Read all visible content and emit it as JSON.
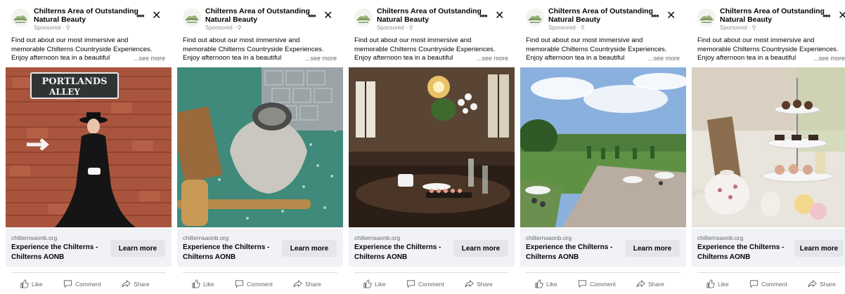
{
  "cards": [
    {
      "page_name": "Chilterns Area of Outstanding Natural Beauty",
      "sponsored": "Sponsored · ⚲",
      "text_lines": [
        "Find out about our most immersive and",
        "memorable Chilterns Countryside Experiences.",
        "Enjoy afternoon tea in a beautiful"
      ],
      "see_more": "...see more",
      "sign_line1": "PORTLANDS",
      "sign_line2": "ALLEY",
      "domain": "chilternsaonb.org",
      "headline": "Experience the Chilterns - Chilterns AONB",
      "cta": "Learn more",
      "like": "Like",
      "comment": "Comment",
      "share": "Share"
    },
    {
      "page_name": "Chilterns Area of Outstanding Natural Beauty",
      "sponsored": "Sponsored · ⚲",
      "text_lines": [
        "Find out about our most immersive and",
        "memorable Chilterns Countryside Experiences.",
        "Enjoy afternoon tea in a beautiful"
      ],
      "see_more": "...see more",
      "domain": "chilternsaonb.org",
      "headline": "Experience the Chilterns - Chilterns AONB",
      "cta": "Learn more",
      "like": "Like",
      "comment": "Comment",
      "share": "Share"
    },
    {
      "page_name": "Chilterns Area of Outstanding Natural Beauty",
      "sponsored": "Sponsored · ⚲",
      "text_lines": [
        "Find out about our most immersive and",
        "memorable Chilterns Countryside Experiences.",
        "Enjoy afternoon tea in a beautiful"
      ],
      "see_more": "...see more",
      "domain": "chilternsaonb.org",
      "headline": "Experience the Chilterns - Chilterns AONB",
      "cta": "Learn more",
      "like": "Like",
      "comment": "Comment",
      "share": "Share"
    },
    {
      "page_name": "Chilterns Area of Outstanding Natural Beauty",
      "sponsored": "Sponsored · ⚲",
      "text_lines": [
        "Find out about our most immersive and",
        "memorable Chilterns Countryside Experiences.",
        "Enjoy afternoon tea in a beautiful"
      ],
      "see_more": "...see more",
      "domain": "chilternsaonb.org",
      "headline": "Experience the Chilterns - Chilterns AONB",
      "cta": "Learn more",
      "like": "Like",
      "comment": "Comment",
      "share": "Share"
    },
    {
      "page_name": "Chilterns Area of Outstanding Natural Beauty",
      "sponsored": "Sponsored · ⚲",
      "text_lines": [
        "Find out about our most immersive and",
        "memorable Chilterns Countryside Experiences.",
        "Enjoy afternoon tea in a beautiful"
      ],
      "see_more": "...see more",
      "domain": "chilternsaonb.org",
      "headline": "Experience the Chilterns - Chilterns AONB",
      "cta": "Learn more",
      "like": "Like",
      "comment": "Comment",
      "share": "Share"
    }
  ],
  "icons": {
    "more": "more-dots-icon",
    "close": "close-icon",
    "like": "thumbs-up-icon",
    "comment": "comment-bubble-icon",
    "share": "share-arrow-icon",
    "logo": "chilterns-aonb-logo"
  },
  "colors": {
    "cta_background": "#e4e6eb",
    "footer_background": "#f0f2f5",
    "secondary_text": "#65676b"
  }
}
